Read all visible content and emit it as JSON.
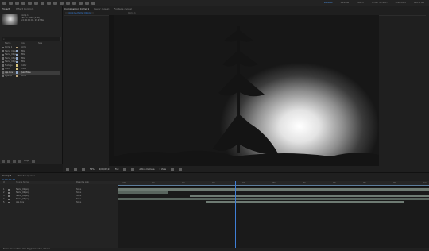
{
  "workspaces": [
    "Default",
    "Review",
    "Learn",
    "Small Screen",
    "Standard",
    "Libraries"
  ],
  "active_workspace": "Default",
  "project_panel": {
    "tabs": [
      "Project",
      "Effect Controls"
    ],
    "thumb_info": [
      "Comp 1",
      "1920 x 1080 (1.00)",
      "Δ 0;00;10;00, 29.97 fps"
    ],
    "search_placeholder": "",
    "header": [
      "Name",
      "Type",
      "Size"
    ],
    "items": [
      {
        "name": "Comp 1",
        "type": "Comp",
        "color": "#b9a37a"
      },
      {
        "name": "frame_01.png",
        "type": "PNG",
        "color": "#8fa6c8"
      },
      {
        "name": "frame_02.png",
        "type": "PNG",
        "color": "#8fa6c8"
      },
      {
        "name": "frame_03.png",
        "type": "PNG",
        "color": "#8fa6c8"
      },
      {
        "name": "frame_04.png",
        "type": "PNG",
        "color": "#8fa6c8"
      },
      {
        "name": "Footage",
        "type": "Folder",
        "color": "#d6c37a"
      },
      {
        "name": "Solids",
        "type": "Folder",
        "color": "#d6c37a"
      },
      {
        "name": "clip.mov",
        "type": "QuickTime",
        "color": "#8fa6c8"
      },
      {
        "name": "layer_a",
        "type": "Comp",
        "color": "#b9a37a"
      }
    ],
    "selected_index": 7,
    "footer_bpc": "8 bpc"
  },
  "viewer": {
    "tabs": [
      "Composition Comp 1",
      "Layer (none)",
      "Footage (none)"
    ],
    "crumb": "Comp 1 ▸ frame_01.png",
    "crumb2": "Comp 1",
    "zoom": "50%",
    "timecode": "0;00;02;11",
    "resolution": "Full",
    "camera": "Active Camera",
    "view": "1 View"
  },
  "timeline": {
    "tabs": [
      "Comp 1",
      "Render Queue"
    ],
    "timecode": "0;00;02;11",
    "layer_header": [
      "#",
      "Source Name",
      "Parent & Link"
    ],
    "layers": [
      {
        "num": "1",
        "name": "frame_01.png",
        "parent": "None"
      },
      {
        "num": "2",
        "name": "frame_02.png",
        "parent": "None"
      },
      {
        "num": "3",
        "name": "frame_03.png",
        "parent": "None"
      },
      {
        "num": "4",
        "name": "frame_04.png",
        "parent": "None"
      },
      {
        "num": "5",
        "name": "clip.mov",
        "parent": "None"
      }
    ],
    "ruler_ticks": [
      "0:00s",
      "01s",
      "02s",
      "03s",
      "04s",
      "05s",
      "06s",
      "07s",
      "08s",
      "09s",
      "10s"
    ],
    "footer": "Frame Render Time 0ms    Toggle Switches / Modes"
  }
}
